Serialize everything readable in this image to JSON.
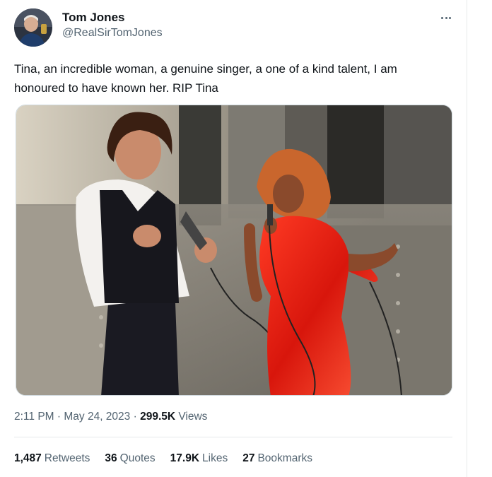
{
  "author": {
    "name": "Tom Jones",
    "handle": "@RealSirTomJones"
  },
  "tweet": {
    "text": "Tina, an incredible woman, a genuine singer, a one of a kind talent, I am\nhonoured to have known her. RIP Tina"
  },
  "meta": {
    "time": "2:11 PM",
    "sep1": " · ",
    "date": "May 24, 2023",
    "sep2": " · ",
    "views_count": "299.5K",
    "views_label": " Views"
  },
  "stats": {
    "retweets_count": "1,487",
    "retweets_label": "Retweets",
    "quotes_count": "36",
    "quotes_label": "Quotes",
    "likes_count": "17.9K",
    "likes_label": "Likes",
    "bookmarks_count": "27",
    "bookmarks_label": "Bookmarks"
  },
  "icons": {
    "more": "more-options-icon"
  }
}
